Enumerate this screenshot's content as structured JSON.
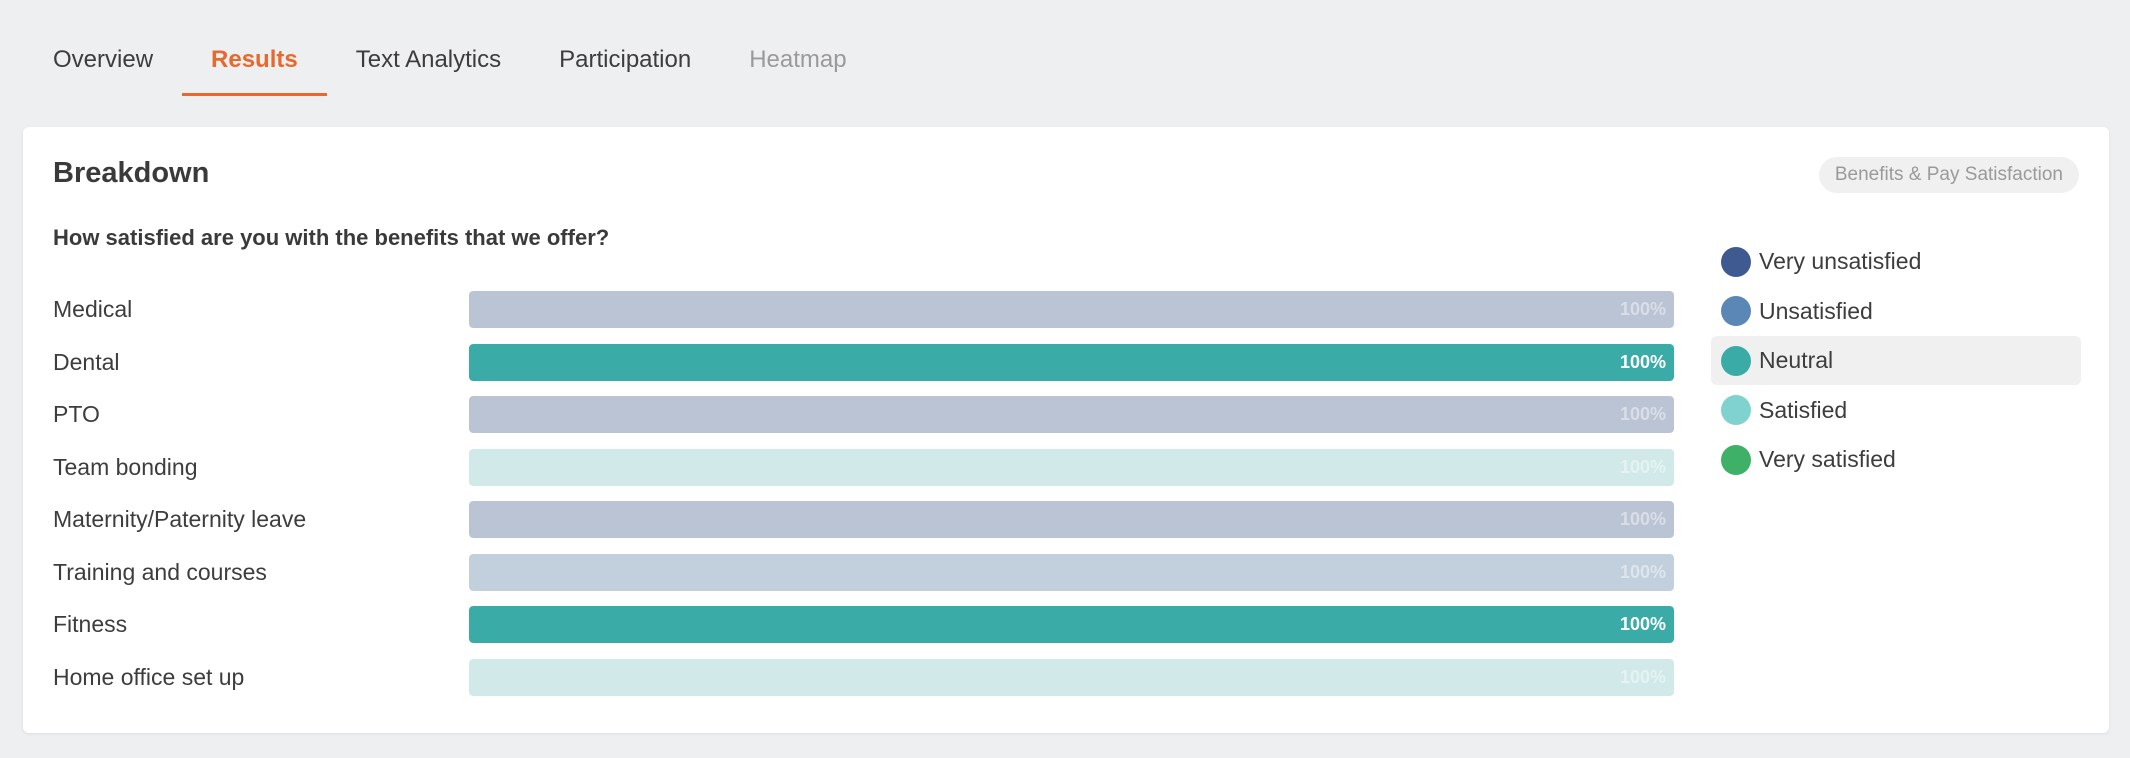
{
  "tabs": [
    {
      "label": "Overview",
      "state": "normal"
    },
    {
      "label": "Results",
      "state": "active"
    },
    {
      "label": "Text Analytics",
      "state": "normal"
    },
    {
      "label": "Participation",
      "state": "normal"
    },
    {
      "label": "Heatmap",
      "state": "muted"
    }
  ],
  "card": {
    "title": "Breakdown",
    "category": "Benefits & Pay Satisfaction",
    "question": "How satisfied are you with the benefits that we offer?"
  },
  "colors": {
    "accent": "#e8692e",
    "very_unsatisfied": "#3f5a91",
    "unsatisfied": "#5b87b7",
    "neutral": "#3aaba6",
    "satisfied": "#7fd2ce",
    "very_satisfied": "#3fb068"
  },
  "rows": [
    {
      "label": "Medical",
      "value_text": "100%",
      "fraction": 1.0,
      "color": "#bbc4d5",
      "emphasis": false
    },
    {
      "label": "Dental",
      "value_text": "100%",
      "fraction": 1.0,
      "color": "#3aaba6",
      "emphasis": true
    },
    {
      "label": "PTO",
      "value_text": "100%",
      "fraction": 1.0,
      "color": "#bbc4d5",
      "emphasis": false
    },
    {
      "label": "Team bonding",
      "value_text": "100%",
      "fraction": 1.0,
      "color": "#d1e9e9",
      "emphasis": false
    },
    {
      "label": "Maternity/Paternity leave",
      "value_text": "100%",
      "fraction": 1.0,
      "color": "#bbc4d5",
      "emphasis": false
    },
    {
      "label": "Training and courses",
      "value_text": "100%",
      "fraction": 1.0,
      "color": "#c2d0de",
      "emphasis": false
    },
    {
      "label": "Fitness",
      "value_text": "100%",
      "fraction": 1.0,
      "color": "#3aaba6",
      "emphasis": true
    },
    {
      "label": "Home office set up",
      "value_text": "100%",
      "fraction": 1.0,
      "color": "#d1e9e9",
      "emphasis": false
    }
  ],
  "legend": [
    {
      "label": "Very unsatisfied",
      "color": "#3f5a91",
      "highlight": false
    },
    {
      "label": "Unsatisfied",
      "color": "#5b87b7",
      "highlight": false
    },
    {
      "label": "Neutral",
      "color": "#3aaba6",
      "highlight": true
    },
    {
      "label": "Satisfied",
      "color": "#7fd2ce",
      "highlight": false
    },
    {
      "label": "Very satisfied",
      "color": "#3fb068",
      "highlight": false
    }
  ]
}
